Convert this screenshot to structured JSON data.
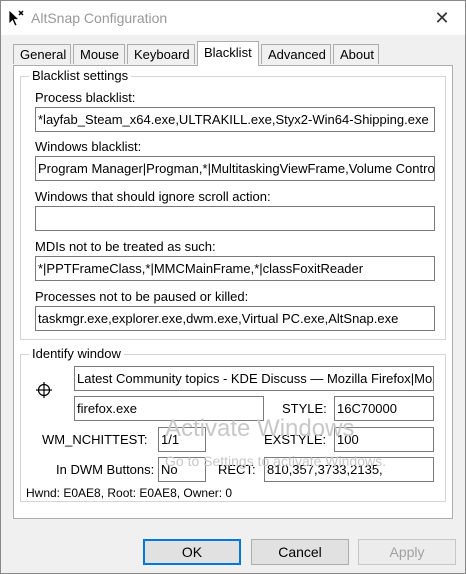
{
  "window": {
    "title": "AltSnap Configuration"
  },
  "tabs": [
    {
      "label": "General"
    },
    {
      "label": "Mouse"
    },
    {
      "label": "Keyboard"
    },
    {
      "label": "Blacklist"
    },
    {
      "label": "Advanced"
    },
    {
      "label": "About"
    }
  ],
  "active_tab": "Blacklist",
  "blacklist": {
    "legend": "Blacklist settings",
    "process_label": "Process blacklist:",
    "process_value": "*layfab_Steam_x64.exe,ULTRAKILL.exe,Styx2-Win64-Shipping.exe",
    "windows_label": "Windows blacklist:",
    "windows_value": "Program Manager|Progman,*|MultitaskingViewFrame,Volume Control",
    "scroll_label": "Windows that should ignore scroll action:",
    "scroll_value": "",
    "mdi_label": "MDIs not to be treated as such:",
    "mdi_value": "*|PPTFrameClass,*|MMCMainFrame,*|classFoxitReader",
    "pause_label": "Processes not to be paused or killed:",
    "pause_value": "taskmgr.exe,explorer.exe,dwm.exe,Virtual PC.exe,AltSnap.exe"
  },
  "identify": {
    "legend": "Identify window",
    "window_title_value": "Latest Community topics - KDE Discuss — Mozilla Firefox|MozillaWindowClass",
    "process_value": "firefox.exe",
    "style_label": "STYLE:",
    "style_value": "16C70000",
    "nchittest_label": "WM_NCHITTEST:",
    "nchittest_value": "1/1",
    "exstyle_label": "EXSTYLE:",
    "exstyle_value": "100",
    "dwm_label": "In DWM Buttons:",
    "dwm_value": "No",
    "rect_label": "RECT:",
    "rect_value": "810,357,3733,2135,",
    "hwnd_text": "Hwnd: E0AE8, Root: E0AE8, Owner: 0"
  },
  "watermark": {
    "line1": "Activate Windows",
    "line2": "Go to Settings to activate Windows."
  },
  "buttons": {
    "ok": "OK",
    "cancel": "Cancel",
    "apply": "Apply"
  }
}
